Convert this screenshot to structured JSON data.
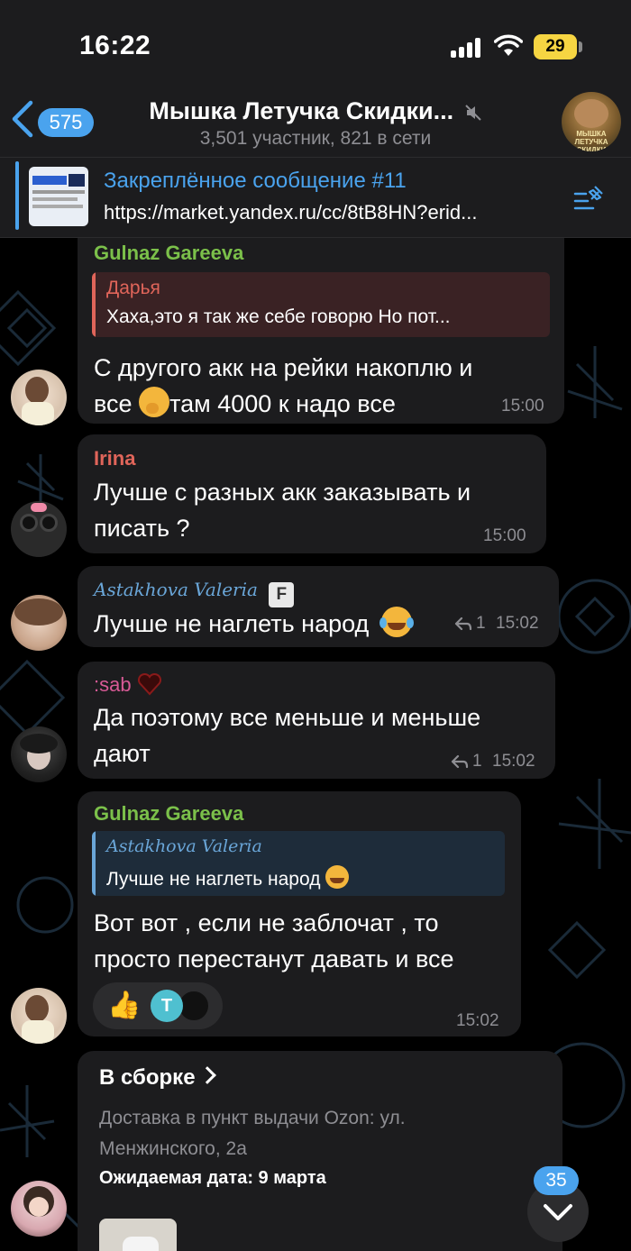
{
  "status_bar": {
    "time": "16:22",
    "battery": "29"
  },
  "header": {
    "back_count": "575",
    "title": "Мышка Летучка Скидки...",
    "subtitle": "3,501 участник, 821 в сети",
    "avatar_text": "МЫШКА ЛЕТУЧКА СКИДКИ"
  },
  "pinned": {
    "title": "Закреплённое сообщение #11",
    "text": "https://market.yandex.ru/cc/8tB8HN?erid..."
  },
  "messages": [
    {
      "sender": "Gulnaz Gareeva",
      "reply_name": "Дарья",
      "reply_text": "Хаха,это я так же себе говорю Но пот...",
      "text_line1": "С другого акк на рейки накоплю и",
      "text_line2_a": "все",
      "text_line2_b": "там 4000 к надо все",
      "time": "15:00"
    },
    {
      "sender": "Irina",
      "text_line1": "Лучше с разных акк заказывать и",
      "text_line2": "писать ?",
      "time": "15:00"
    },
    {
      "sender": "Astakhova Valeria",
      "sender_badge": "F",
      "text": "Лучше не наглеть народ",
      "replies": "1",
      "time": "15:02"
    },
    {
      "sender": ":sab",
      "text_line1": "Да поэтому все меньше и меньше",
      "text_line2": "дают",
      "replies": "1",
      "time": "15:02"
    },
    {
      "sender": "Gulnaz Gareeva",
      "reply_name": "Astakhova Valeria",
      "reply_text": "Лучше не наглеть народ",
      "text_line1": "Вот вот , если не заблочат , то",
      "text_line2": "просто перестанут давать и все",
      "reaction_emoji": "👍",
      "reaction_user_initial": "T",
      "time": "15:02"
    }
  ],
  "order": {
    "title": "В сборке",
    "address": "Доставка в пункт выдачи Ozon: ул. Менжинского, 2а",
    "date": "Ожидаемая дата: 9 марта"
  },
  "scroll": {
    "unread": "35"
  },
  "colors": {
    "accent": "#4aa3ee",
    "gulnaz": "#7bc04a",
    "darya": "#e0655a",
    "irina": "#e0655a",
    "valeria": "#6aa6d8",
    "sab": "#d85a96",
    "bubble": "#1c1c1e"
  }
}
